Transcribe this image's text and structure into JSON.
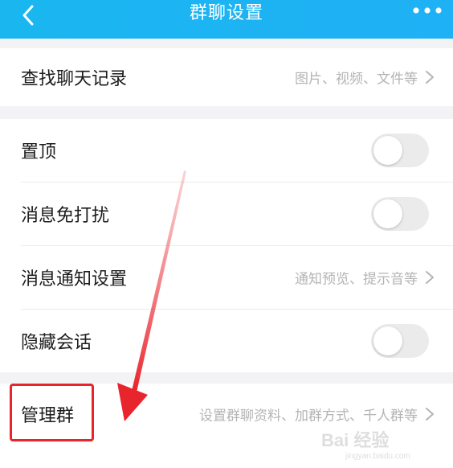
{
  "header": {
    "title": "群聊设置",
    "back_icon": "chevron-left-icon",
    "more_icon": "more-dots-icon",
    "color": "#1ab6f0"
  },
  "rows": {
    "search_history": {
      "label": "查找聊天记录",
      "hint": "图片、视频、文件等"
    },
    "pin": {
      "label": "置顶",
      "toggle_on": false
    },
    "mute": {
      "label": "消息免打扰",
      "toggle_on": false
    },
    "notify": {
      "label": "消息通知设置",
      "hint": "通知预览、提示音等"
    },
    "hide": {
      "label": "隐藏会话",
      "toggle_on": false
    },
    "manage": {
      "label": "管理群",
      "hint": "设置群聊资料、加群方式、千人群等"
    }
  },
  "annotation": {
    "color": "#e8242c",
    "target": "管理群"
  },
  "watermark": {
    "text": "Bai 经验",
    "url": "jingyan.baidu.com"
  }
}
